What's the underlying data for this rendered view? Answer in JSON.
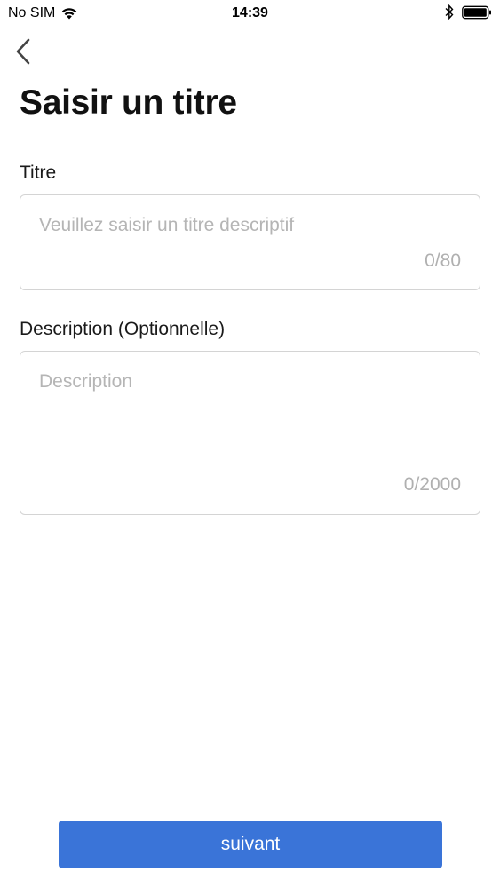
{
  "status_bar": {
    "carrier": "No SIM",
    "time": "14:39",
    "icons": [
      "wifi-icon",
      "bluetooth-icon",
      "battery-icon"
    ]
  },
  "header": {
    "back_icon": "chevron-left-icon",
    "title": "Saisir un titre"
  },
  "form": {
    "title_field": {
      "label": "Titre",
      "value": "",
      "placeholder": "Veuillez saisir un titre descriptif",
      "counter": "0/80"
    },
    "description_field": {
      "label": "Description (Optionnelle)",
      "value": "",
      "placeholder": "Description",
      "counter": "0/2000"
    }
  },
  "footer": {
    "next_label": "suivant"
  },
  "colors": {
    "accent": "#3a74d8",
    "placeholder": "#b5b5b5",
    "border": "#d4d4d4"
  }
}
